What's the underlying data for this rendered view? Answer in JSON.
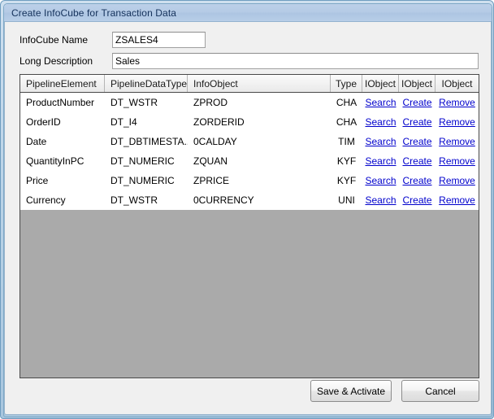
{
  "window": {
    "title": "Create InfoCube for Transaction Data"
  },
  "form": {
    "infocube_name": {
      "label": "InfoCube Name",
      "value": "ZSALES4"
    },
    "long_description": {
      "label": "Long Description",
      "value": "Sales"
    }
  },
  "grid": {
    "columns": [
      "PipelineElement",
      "PipelineDataType",
      "InfoObject",
      "Type",
      "IObject",
      "IObject",
      "IObject"
    ],
    "rows": [
      {
        "element": "ProductNumber",
        "datatype": "DT_WSTR",
        "infoobject": "ZPROD",
        "type": "CHA",
        "search": "Search",
        "create": "Create",
        "remove": "Remove"
      },
      {
        "element": "OrderID",
        "datatype": "DT_I4",
        "infoobject": "ZORDERID",
        "type": "CHA",
        "search": "Search",
        "create": "Create",
        "remove": "Remove"
      },
      {
        "element": "Date",
        "datatype": "DT_DBTIMESTA...",
        "infoobject": "0CALDAY",
        "type": "TIM",
        "search": "Search",
        "create": "Create",
        "remove": "Remove"
      },
      {
        "element": "QuantityInPC",
        "datatype": "DT_NUMERIC",
        "infoobject": "ZQUAN",
        "type": "KYF",
        "search": "Search",
        "create": "Create",
        "remove": "Remove"
      },
      {
        "element": "Price",
        "datatype": "DT_NUMERIC",
        "infoobject": "ZPRICE",
        "type": "KYF",
        "search": "Search",
        "create": "Create",
        "remove": "Remove"
      },
      {
        "element": "Currency",
        "datatype": "DT_WSTR",
        "infoobject": "0CURRENCY",
        "type": "UNI",
        "search": "Search",
        "create": "Create",
        "remove": "Remove"
      }
    ]
  },
  "footer": {
    "save_label": "Save & Activate",
    "cancel_label": "Cancel"
  },
  "colors": {
    "link": "#0000cc",
    "grid_empty": "#aaaaaa",
    "dialog_bg": "#f0f0f0",
    "titlebar": "#b5cbe6"
  }
}
